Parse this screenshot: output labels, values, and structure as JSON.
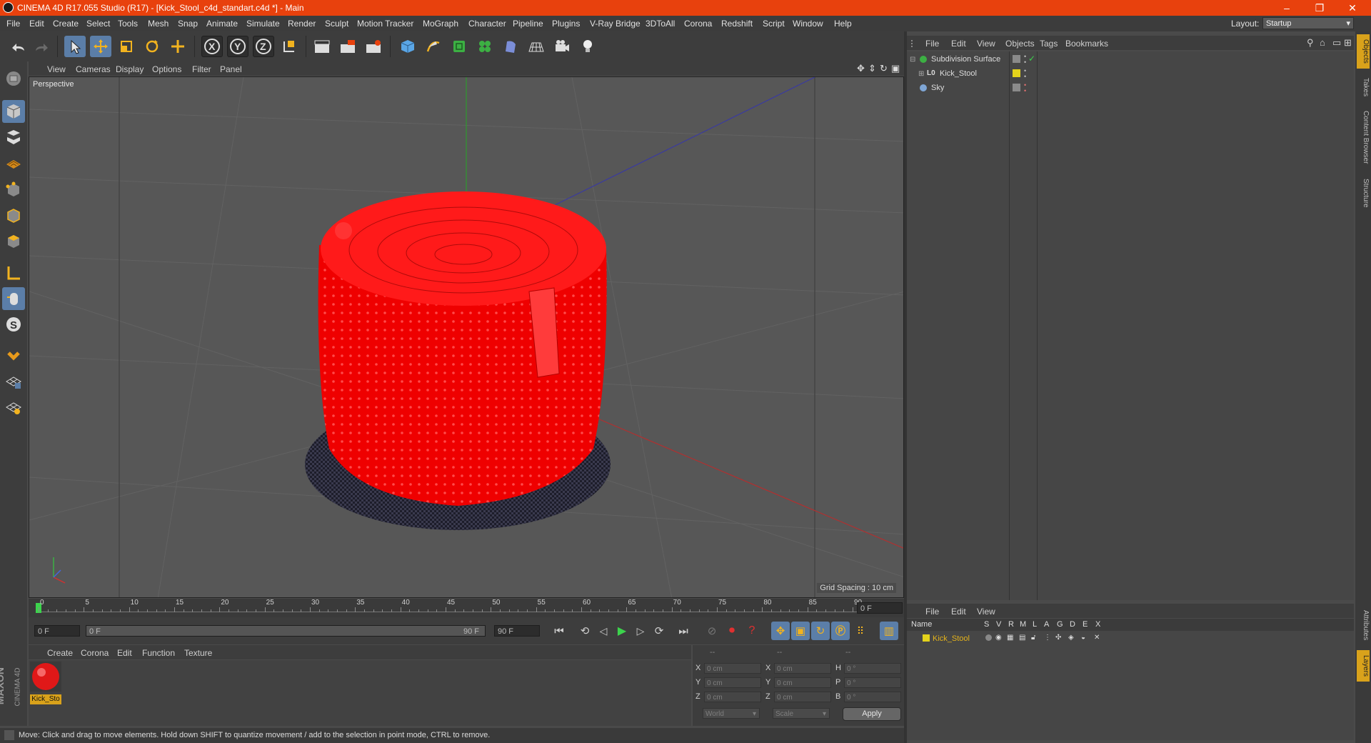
{
  "window": {
    "title": "CINEMA 4D R17.055 Studio (R17) - [Kick_Stool_c4d_standart.c4d *] - Main",
    "controls": [
      "–",
      "❐",
      "✕"
    ]
  },
  "menubar": {
    "items": [
      "File",
      "Edit",
      "Create",
      "Select",
      "Tools",
      "Mesh",
      "Snap",
      "Animate",
      "Simulate",
      "Render",
      "Sculpt",
      "Motion Tracker",
      "MoGraph",
      "Character",
      "Pipeline",
      "Plugins",
      "V-Ray Bridge",
      "3DToAll",
      "Corona",
      "Redshift",
      "Script",
      "Window",
      "Help"
    ],
    "layout_label": "Layout:",
    "layout_value": "Startup"
  },
  "viewport": {
    "menu": [
      "View",
      "Cameras",
      "Display",
      "Options",
      "Filter",
      "Panel"
    ],
    "camera_label": "Perspective",
    "grid_spacing": "Grid Spacing : 10 cm"
  },
  "timeline": {
    "ticks": [
      "0",
      "5",
      "10",
      "15",
      "20",
      "25",
      "30",
      "35",
      "40",
      "45",
      "50",
      "55",
      "60",
      "65",
      "70",
      "75",
      "80",
      "85",
      "90"
    ],
    "current_frame": "0 F",
    "start_field": "0 F",
    "range_start": "0 F",
    "range_end": "90 F",
    "end_field": "90 F"
  },
  "materials": {
    "menu": [
      "Create",
      "Corona",
      "Edit",
      "Function",
      "Texture"
    ],
    "items": [
      {
        "name": "Kick_Sto"
      }
    ]
  },
  "coordinates": {
    "headers": [
      "--",
      "--",
      "--"
    ],
    "rows": [
      {
        "a": "X",
        "av": "0 cm",
        "b": "X",
        "bv": "0 cm",
        "c": "H",
        "cv": "0 °"
      },
      {
        "a": "Y",
        "av": "0 cm",
        "b": "Y",
        "bv": "0 cm",
        "c": "P",
        "cv": "0 °"
      },
      {
        "a": "Z",
        "av": "0 cm",
        "b": "Z",
        "bv": "0 cm",
        "c": "B",
        "cv": "0 °"
      }
    ],
    "mode": "World",
    "scale": "Scale",
    "apply": "Apply"
  },
  "objects": {
    "menu": [
      "File",
      "Edit",
      "View",
      "Objects",
      "Tags",
      "Bookmarks"
    ],
    "items": [
      {
        "name": "Subdivision Surface",
        "color": "#3cb043"
      },
      {
        "name": "Kick_Stool",
        "color": "#e3d21b"
      },
      {
        "name": "Sky",
        "color": "#7fa6d6"
      }
    ]
  },
  "layers": {
    "menu": [
      "File",
      "Edit",
      "View"
    ],
    "columns": [
      "Name",
      "S",
      "V",
      "R",
      "M",
      "L",
      "A",
      "G",
      "D",
      "E",
      "X"
    ],
    "items": [
      {
        "name": "Kick_Stool",
        "color": "#e3d21b"
      }
    ]
  },
  "right_tabs": [
    "Objects",
    "Takes",
    "Content Browser",
    "Structure",
    "Attributes",
    "Layers"
  ],
  "brand": [
    "MAXON",
    "CINEMA 4D"
  ],
  "status": "Move: Click and drag to move elements. Hold down SHIFT to quantize movement / add to the selection in point mode, CTRL to remove."
}
